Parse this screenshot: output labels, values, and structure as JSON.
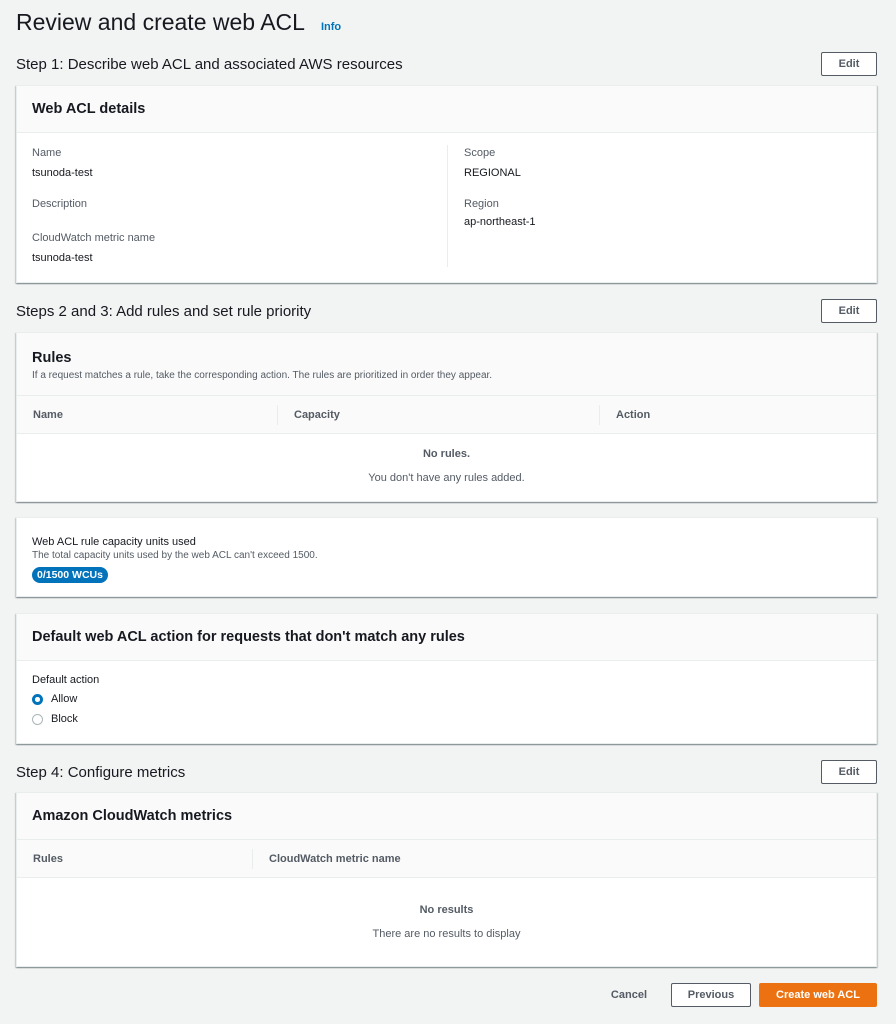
{
  "page": {
    "title": "Review and create web ACL",
    "info_link": "Info"
  },
  "step1": {
    "title": "Step 1: Describe web ACL and associated AWS resources",
    "edit_label": "Edit",
    "card_title": "Web ACL details",
    "left": [
      {
        "label": "Name",
        "value": "tsunoda-test"
      },
      {
        "label": "Description",
        "value": ""
      },
      {
        "label": "CloudWatch metric name",
        "value": "tsunoda-test"
      }
    ],
    "right": [
      {
        "label": "Scope",
        "value": "REGIONAL"
      },
      {
        "label": "Region",
        "value": "ap-northeast-1"
      }
    ]
  },
  "step23": {
    "title": "Steps 2 and 3: Add rules and set rule priority",
    "edit_label": "Edit",
    "card_title": "Rules",
    "card_desc": "If a request matches a rule, take the corresponding action. The rules are prioritized in order they appear.",
    "columns": [
      "Name",
      "Capacity",
      "Action"
    ],
    "empty_title": "No rules.",
    "empty_sub": "You don't have any rules added."
  },
  "capacity": {
    "label": "Web ACL rule capacity units used",
    "desc": "The total capacity units used by the web ACL can't exceed 1500.",
    "badge": "0/1500 WCUs"
  },
  "default_action": {
    "card_title": "Default web ACL action for requests that don't match any rules",
    "label": "Default action",
    "options": [
      {
        "label": "Allow",
        "selected": true
      },
      {
        "label": "Block",
        "selected": false
      }
    ]
  },
  "step4": {
    "title": "Step 4: Configure metrics",
    "edit_label": "Edit",
    "card_title": "Amazon CloudWatch metrics",
    "columns": [
      "Rules",
      "CloudWatch metric name"
    ],
    "empty_title": "No results",
    "empty_sub": "There are no results to display"
  },
  "footer": {
    "cancel": "Cancel",
    "previous": "Previous",
    "create": "Create web ACL"
  },
  "colors": {
    "accent": "#0073bb",
    "primary_button": "#ec7211",
    "background": "#f2f3f3"
  }
}
